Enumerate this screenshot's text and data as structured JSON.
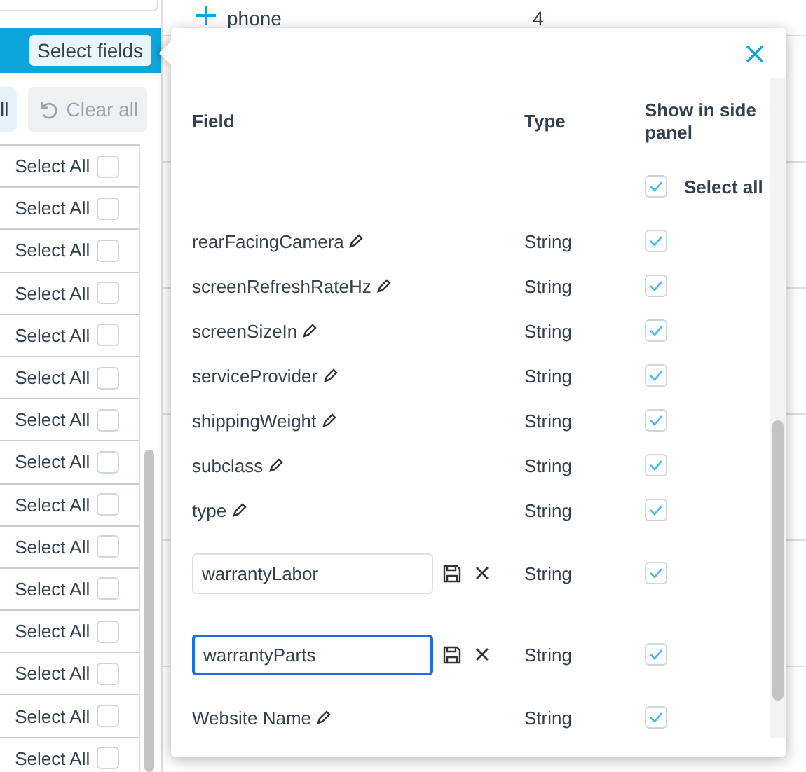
{
  "background": {
    "rows": [
      {
        "name": "phone",
        "value": "4"
      }
    ]
  },
  "left_panel": {
    "header_button": "Select fields",
    "toolbar": [
      {
        "label": "ll",
        "kind": "select",
        "disabled": false
      },
      {
        "label": "Clear all",
        "kind": "clear",
        "disabled": true
      }
    ],
    "rows": [
      {
        "label": "Select All",
        "checked": false
      },
      {
        "label": "Select All",
        "checked": false
      },
      {
        "label": "Select All",
        "checked": false
      },
      {
        "label": "Select All",
        "checked": false
      },
      {
        "label": "Select All",
        "checked": false
      },
      {
        "label": "Select All",
        "checked": false
      },
      {
        "label": "Select All",
        "checked": false
      },
      {
        "label": "Select All",
        "checked": false
      },
      {
        "label": "Select All",
        "checked": false
      },
      {
        "label": "Select All",
        "checked": false
      },
      {
        "label": "Select All",
        "checked": false
      },
      {
        "label": "Select All",
        "checked": false
      },
      {
        "label": "Select All",
        "checked": false
      },
      {
        "label": "Select All",
        "checked": false
      },
      {
        "label": "Select All",
        "checked": false
      }
    ]
  },
  "dialog": {
    "columns": [
      "Field",
      "Type",
      "Show in side panel"
    ],
    "select_all": {
      "label": "Select all",
      "checked": true
    },
    "fields": [
      {
        "kind": "text",
        "name": "rearFacingCamera",
        "type": "String",
        "checked": true
      },
      {
        "kind": "text",
        "name": "screenRefreshRateHz",
        "type": "String",
        "checked": true
      },
      {
        "kind": "text",
        "name": "screenSizeIn",
        "type": "String",
        "checked": true
      },
      {
        "kind": "text",
        "name": "serviceProvider",
        "type": "String",
        "checked": true
      },
      {
        "kind": "text",
        "name": "shippingWeight",
        "type": "String",
        "checked": true
      },
      {
        "kind": "text",
        "name": "subclass",
        "type": "String",
        "checked": true
      },
      {
        "kind": "text",
        "name": "type",
        "type": "String",
        "checked": true
      },
      {
        "kind": "edit",
        "name": "warrantyLabor",
        "focused": false,
        "type": "String",
        "checked": true
      },
      {
        "kind": "edit",
        "name": "warrantyParts",
        "focused": true,
        "type": "String",
        "checked": true
      },
      {
        "kind": "text",
        "name": "Website Name",
        "type": "String",
        "checked": true
      }
    ]
  }
}
